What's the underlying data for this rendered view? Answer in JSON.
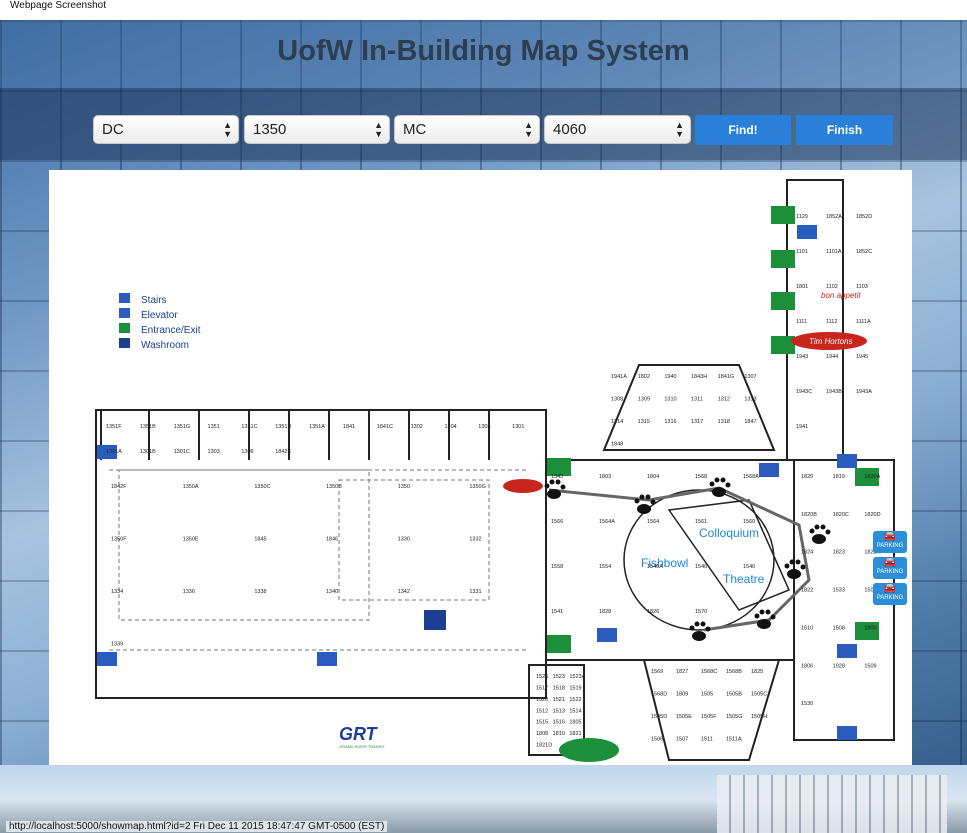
{
  "caption": "Webpage Screenshot",
  "title": "UofW In-Building Map System",
  "selects": [
    {
      "id": "from-building",
      "value": "DC"
    },
    {
      "id": "from-room",
      "value": "1350"
    },
    {
      "id": "to-building",
      "value": "MC"
    },
    {
      "id": "to-room",
      "value": "4060"
    }
  ],
  "buttons": {
    "find": "Find!",
    "finish": "Finish"
  },
  "legend": {
    "stairs": "Stairs",
    "elevator": "Elevator",
    "exit": "Entrance/Exit",
    "washroom": "Washroom"
  },
  "map_labels": {
    "colloquium": "Colloquium",
    "fishbowl": "Fishbowl",
    "theatre": "Theatre",
    "grt": "GRT",
    "grt_sub": "GRAND RIVER TRANSIT",
    "tim": "Tim Hortons",
    "appetit": "bon appetit"
  },
  "rooms": [
    "1129",
    "1852A",
    "1852D",
    "1101",
    "1101A",
    "1852C",
    "1801",
    "1102",
    "1103",
    "1111",
    "1112",
    "1111A",
    "1943",
    "1944",
    "1945",
    "1943C",
    "1943B",
    "1943A",
    "1941",
    "1941A",
    "1802",
    "1940",
    "1843H",
    "1841G",
    "1307",
    "1308",
    "1309",
    "1310",
    "1311",
    "1312",
    "1313",
    "1314",
    "1315",
    "1316",
    "1317",
    "1318",
    "1847",
    "1848",
    "1351F",
    "1351B",
    "1351G",
    "1351",
    "1351C",
    "1351D",
    "1351A",
    "1841",
    "1841C",
    "1302",
    "1304",
    "1305",
    "1301",
    "1301A",
    "1301B",
    "1301C",
    "1303",
    "1306",
    "1842E",
    "1842F",
    "1350A",
    "1350C",
    "1350B",
    "1350",
    "1350G",
    "1350F",
    "1350E",
    "1845",
    "1846",
    "1330",
    "1332",
    "1334",
    "1336",
    "1338",
    "1340",
    "1342",
    "1331",
    "1339",
    "1343",
    "1803",
    "1804",
    "1568",
    "1568A",
    "1566",
    "1564A",
    "1564",
    "1561",
    "1560",
    "1558",
    "1554",
    "1546A",
    "1546",
    "1540",
    "1541",
    "1828",
    "1826",
    "1570",
    "1569",
    "1827",
    "1568C",
    "1568B",
    "1825",
    "1568D",
    "1809",
    "1505",
    "1505B",
    "1505C",
    "1505D",
    "1505E",
    "1505F",
    "1505G",
    "1505H",
    "1506",
    "1507",
    "1511",
    "1511A",
    "1820",
    "1819",
    "1820A",
    "1820B",
    "1820C",
    "1820D",
    "1824",
    "1823",
    "1823A",
    "1822",
    "1533",
    "1501",
    "1510",
    "1508",
    "1800",
    "1806",
    "1928",
    "1509",
    "1530",
    "1526",
    "1523",
    "1523A",
    "1517",
    "1518",
    "1519",
    "1520",
    "1521",
    "1522",
    "1512",
    "1513",
    "1514",
    "1515",
    "1516",
    "1805",
    "1808",
    "1810",
    "1821",
    "1821D"
  ],
  "parking": [
    "PARKING",
    "PARKING",
    "PARKING"
  ],
  "status_url": "http://localhost:5000/showmap.html?id=2 Fri Dec 11 2015 18:47:47 GMT-0500 (EST)"
}
